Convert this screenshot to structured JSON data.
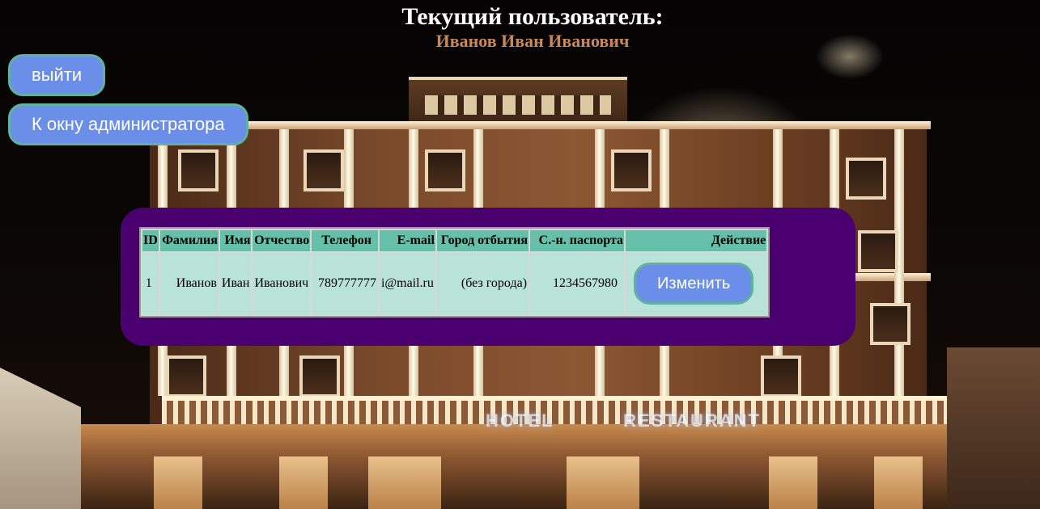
{
  "header": {
    "title": "Текущий пользователь:",
    "user_name": "Иванов Иван Иванович"
  },
  "buttons": {
    "logout": "выйти",
    "admin_window": "К окну администратора"
  },
  "table": {
    "columns": [
      "ID",
      "Фамилия",
      "Имя",
      "Отчество",
      "Телефон",
      "E-mail",
      "Город отбытия",
      "С.-н. паспорта",
      "Действие"
    ],
    "rows": [
      {
        "id": "1",
        "last_name": "Иванов",
        "first_name": "Иван",
        "patronymic": "Иванович",
        "phone": "789777777",
        "email": "i@mail.ru",
        "city": "(без города)",
        "passport": "1234567980",
        "action_label": "Изменить"
      }
    ]
  },
  "background": {
    "sign_left": "HOTEL",
    "sign_right": "RESTAURANT"
  },
  "colors": {
    "button_bg": "#6b8ee8",
    "button_border": "#5fb39e",
    "panel_bg": "#4b0070",
    "table_header_bg": "#66bfa8",
    "table_cell_bg": "#b9e2d8",
    "user_name_color": "#c9885a"
  }
}
